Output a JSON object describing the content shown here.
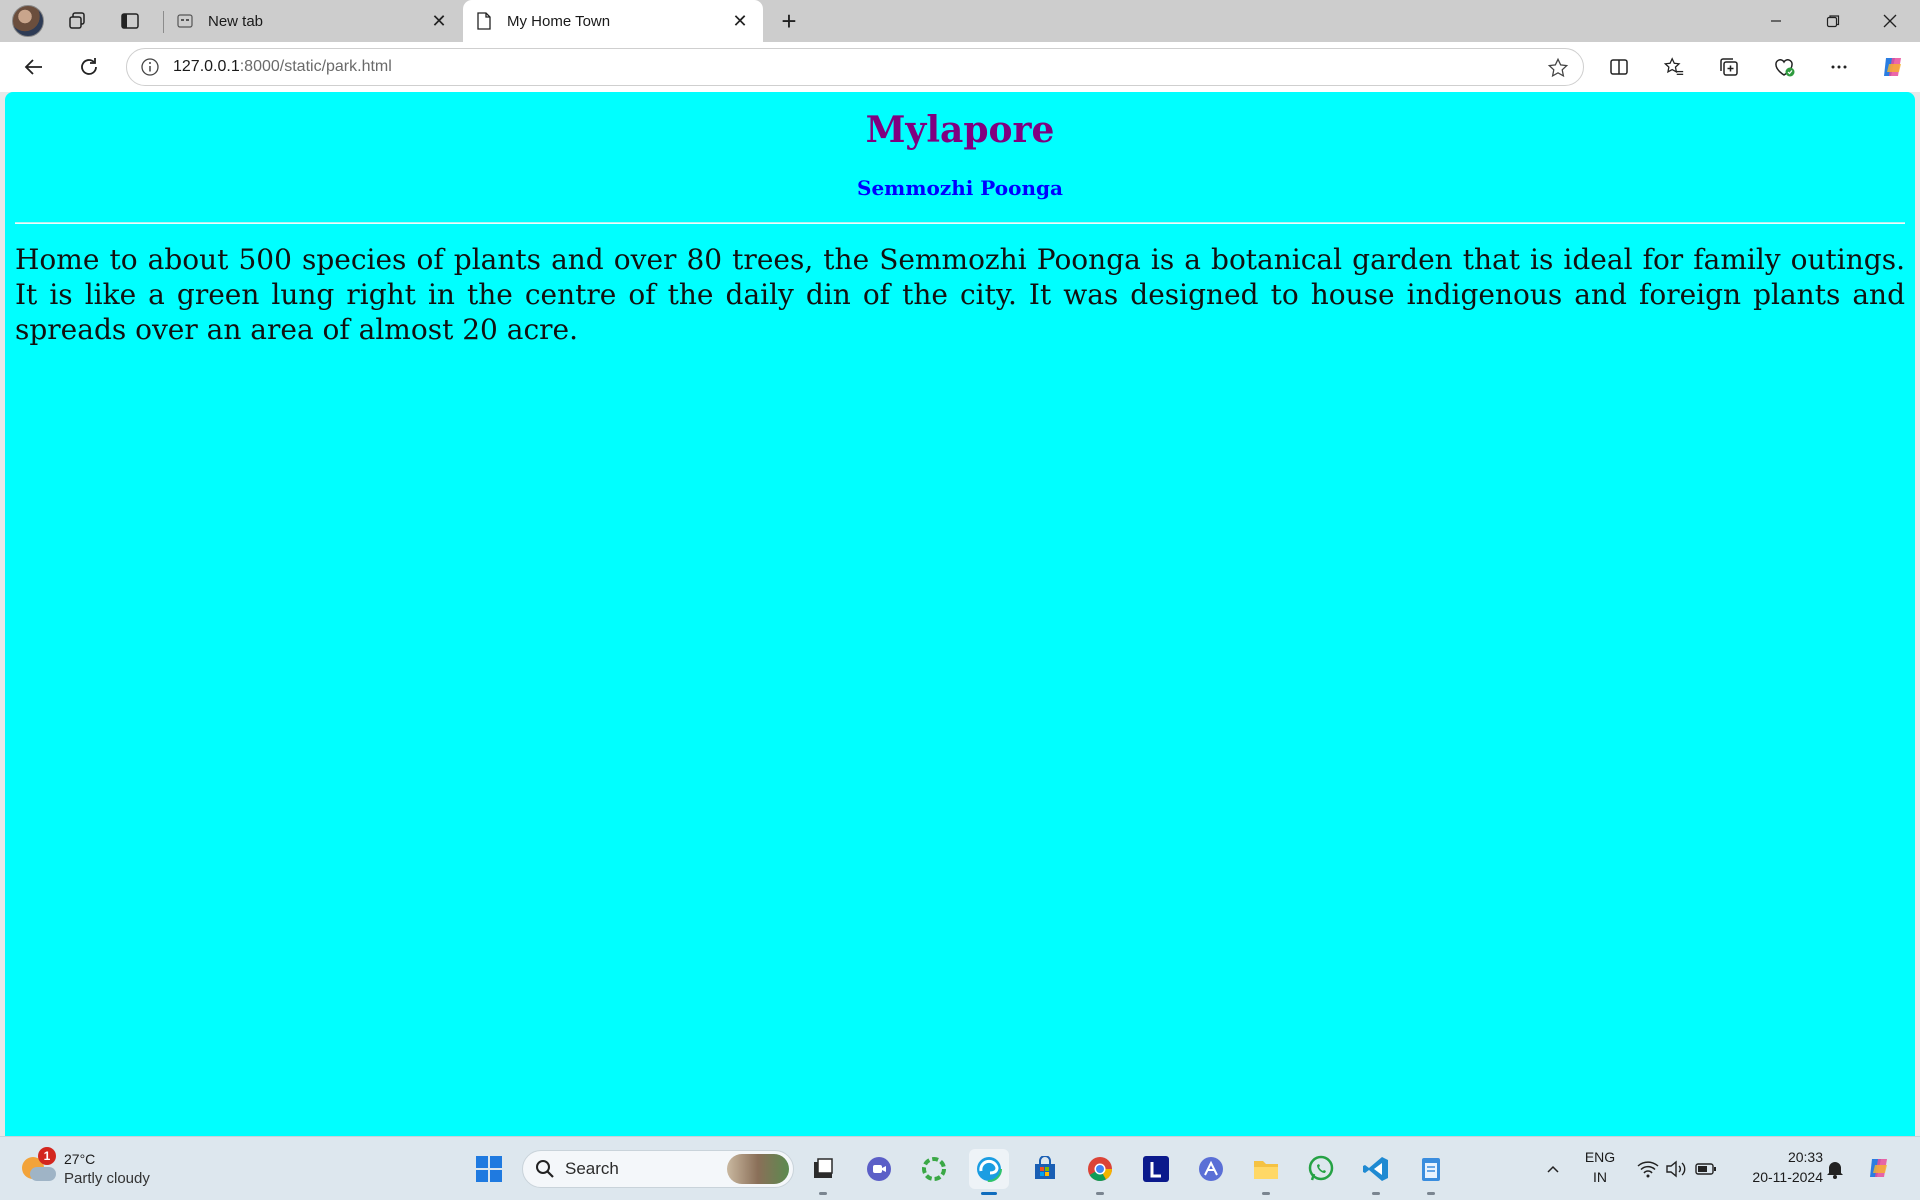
{
  "browser": {
    "tabs": [
      {
        "title": "New tab",
        "active": false
      },
      {
        "title": "My Home Town",
        "active": true
      }
    ],
    "url_host": "127.0.0.1",
    "url_rest": ":8000/static/park.html"
  },
  "page": {
    "heading": "Mylapore",
    "subheading": "Semmozhi Poonga",
    "paragraph": "Home to about 500 species of plants and over 80 trees, the Semmozhi Poonga is a botanical garden that is ideal for family outings. It is like a green lung right in the centre of the daily din of the city. It was designed to house indigenous and foreign plants and spreads over an area of almost 20 acre.",
    "colors": {
      "background": "#00ffff",
      "heading": "#800080",
      "subheading": "#0000ff"
    }
  },
  "taskbar": {
    "weather": {
      "badge": "1",
      "temp": "27°C",
      "condition": "Partly cloudy"
    },
    "search_placeholder": "Search",
    "lang_primary": "ENG",
    "lang_secondary": "IN",
    "time": "20:33",
    "date": "20-11-2024",
    "app_icons": [
      "windows-start-icon",
      "search-icon",
      "file-explorer-dark-icon",
      "teams-icon",
      "refresh-app-icon",
      "edge-icon",
      "microsoft-store-icon",
      "chrome-icon",
      "l-app-icon",
      "ai-app-icon",
      "file-explorer-icon",
      "whatsapp-icon",
      "vscode-icon",
      "notepad-icon"
    ]
  }
}
